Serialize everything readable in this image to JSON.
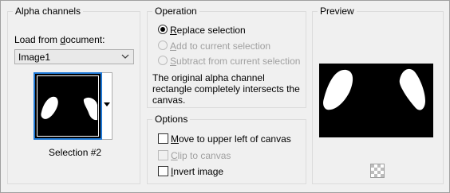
{
  "alpha_channels": {
    "title": "Alpha channels",
    "load_from_label_pre": "Load from ",
    "load_from_label_u": "d",
    "load_from_label_post": "ocument:",
    "document_select_value": "Image1",
    "selection_caption": "Selection #2"
  },
  "operation": {
    "title": "Operation",
    "options": [
      {
        "u": "R",
        "rest": "eplace selection",
        "checked": true,
        "enabled": true
      },
      {
        "u": "A",
        "rest": "dd to current selection",
        "checked": false,
        "enabled": false
      },
      {
        "u": "S",
        "rest": "ubtract from current selection",
        "checked": false,
        "enabled": false
      }
    ],
    "message_line1": "The original alpha channel",
    "message_line2": "rectangle completely intersects the",
    "message_line3": "canvas."
  },
  "options": {
    "title": "Options",
    "checkboxes": [
      {
        "u": "M",
        "rest": "ove to upper left of canvas",
        "checked": false,
        "enabled": true
      },
      {
        "u": "C",
        "rest": "lip to canvas",
        "checked": false,
        "enabled": false
      },
      {
        "u": "I",
        "rest": "nvert image",
        "checked": false,
        "enabled": true
      }
    ]
  },
  "preview": {
    "title": "Preview"
  },
  "icons": {
    "dropdown": "chevron-down-icon",
    "thumb_dropdown": "triangle-down-icon",
    "transparency": "checkerboard-icon"
  }
}
